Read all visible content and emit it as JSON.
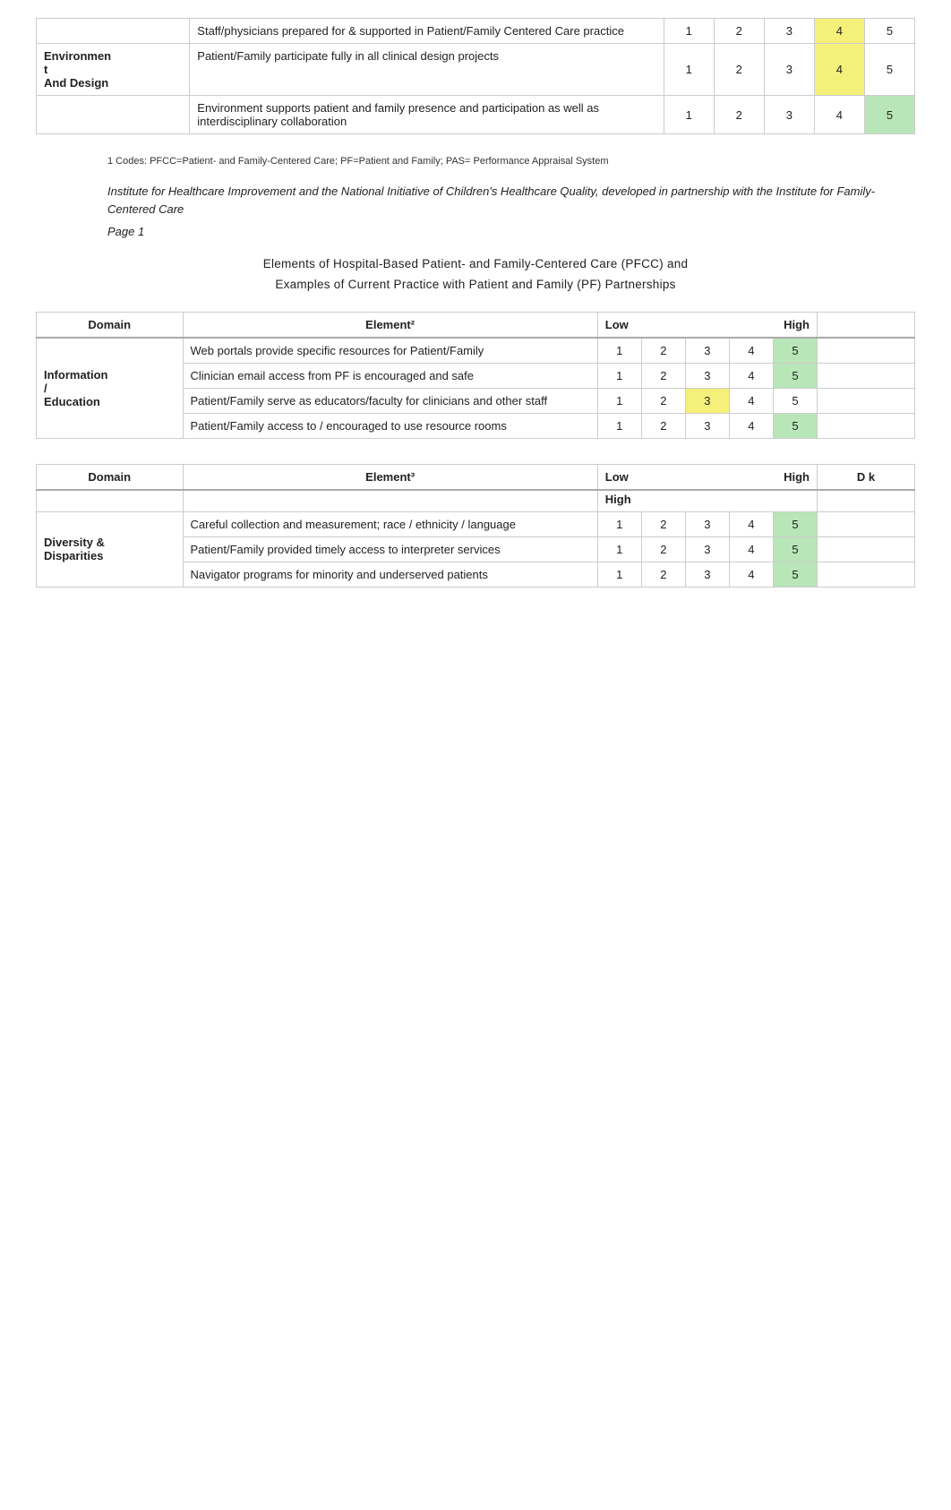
{
  "top_table": {
    "rows": [
      {
        "domain": "",
        "element": "Staff/physicians prepared for & supported in Patient/Family Centered Care practice",
        "scores": [
          {
            "val": "1",
            "highlight": ""
          },
          {
            "val": "2",
            "highlight": ""
          },
          {
            "val": "3",
            "highlight": ""
          },
          {
            "val": "4",
            "highlight": "yellow"
          },
          {
            "val": "5",
            "highlight": ""
          }
        ]
      },
      {
        "domain": "Environment And Design",
        "element": "Patient/Family participate fully in all clinical design projects",
        "scores": [
          {
            "val": "1",
            "highlight": ""
          },
          {
            "val": "2",
            "highlight": ""
          },
          {
            "val": "3",
            "highlight": ""
          },
          {
            "val": "4",
            "highlight": "yellow"
          },
          {
            "val": "5",
            "highlight": ""
          }
        ]
      },
      {
        "domain": "",
        "element": "Environment supports patient and family presence and participation as well as interdisciplinary collaboration",
        "scores": [
          {
            "val": "1",
            "highlight": ""
          },
          {
            "val": "2",
            "highlight": ""
          },
          {
            "val": "3",
            "highlight": ""
          },
          {
            "val": "4",
            "highlight": ""
          },
          {
            "val": "5",
            "highlight": "green"
          }
        ]
      }
    ]
  },
  "footnote": "1 Codes: PFCC=Patient- and Family-Centered Care; PF=Patient and Family; PAS= Performance Appraisal System",
  "attribution": "Institute for Healthcare Improvement and the National Initiative of Children's Healthcare Quality, developed in partnership with the Institute for Family-Centered Care",
  "page_label": "Page 1",
  "center_title": "Elements of Hospital-Based Patient- and Family-Centered Care (PFCC) and Examples of Current Practice with Patient and Family (PF) Partnerships",
  "table2": {
    "domain_header": "Domain",
    "element_header": "Element²",
    "low_label": "Low",
    "high_label": "High",
    "domain": "Information / Education",
    "rows": [
      {
        "element": "Web portals provide specific resources for Patient/Family",
        "scores": [
          {
            "val": "1",
            "highlight": ""
          },
          {
            "val": "2",
            "highlight": ""
          },
          {
            "val": "3",
            "highlight": ""
          },
          {
            "val": "4",
            "highlight": ""
          },
          {
            "val": "5",
            "highlight": "green"
          }
        ]
      },
      {
        "element": "Clinician email access from PF is encouraged and safe",
        "scores": [
          {
            "val": "1",
            "highlight": ""
          },
          {
            "val": "2",
            "highlight": ""
          },
          {
            "val": "3",
            "highlight": ""
          },
          {
            "val": "4",
            "highlight": ""
          },
          {
            "val": "5",
            "highlight": "green"
          }
        ]
      },
      {
        "element": "Patient/Family serve as educators/faculty for clinicians and other staff",
        "scores": [
          {
            "val": "1",
            "highlight": ""
          },
          {
            "val": "2",
            "highlight": ""
          },
          {
            "val": "3",
            "highlight": "yellow"
          },
          {
            "val": "4",
            "highlight": ""
          },
          {
            "val": "5",
            "highlight": ""
          }
        ]
      },
      {
        "element": "Patient/Family access to / encouraged to use resource rooms",
        "scores": [
          {
            "val": "1",
            "highlight": ""
          },
          {
            "val": "2",
            "highlight": ""
          },
          {
            "val": "3",
            "highlight": ""
          },
          {
            "val": "4",
            "highlight": ""
          },
          {
            "val": "5",
            "highlight": "green"
          }
        ]
      }
    ]
  },
  "table3": {
    "domain_header": "Domain",
    "element_header": "Element³",
    "low_label": "Low",
    "high_label": "High",
    "dk_label": "D k",
    "domain": "Diversity & Disparities",
    "rows": [
      {
        "element": "Careful collection and measurement; race / ethnicity / language",
        "scores": [
          {
            "val": "1",
            "highlight": ""
          },
          {
            "val": "2",
            "highlight": ""
          },
          {
            "val": "3",
            "highlight": ""
          },
          {
            "val": "4",
            "highlight": ""
          },
          {
            "val": "5",
            "highlight": "green"
          }
        ]
      },
      {
        "element": "Patient/Family provided timely access to interpreter services",
        "scores": [
          {
            "val": "1",
            "highlight": ""
          },
          {
            "val": "2",
            "highlight": ""
          },
          {
            "val": "3",
            "highlight": ""
          },
          {
            "val": "4",
            "highlight": ""
          },
          {
            "val": "5",
            "highlight": "green"
          }
        ]
      },
      {
        "element": "Navigator programs for minority and underserved patients",
        "scores": [
          {
            "val": "1",
            "highlight": ""
          },
          {
            "val": "2",
            "highlight": ""
          },
          {
            "val": "3",
            "highlight": ""
          },
          {
            "val": "4",
            "highlight": ""
          },
          {
            "val": "5",
            "highlight": "green"
          }
        ]
      }
    ]
  }
}
